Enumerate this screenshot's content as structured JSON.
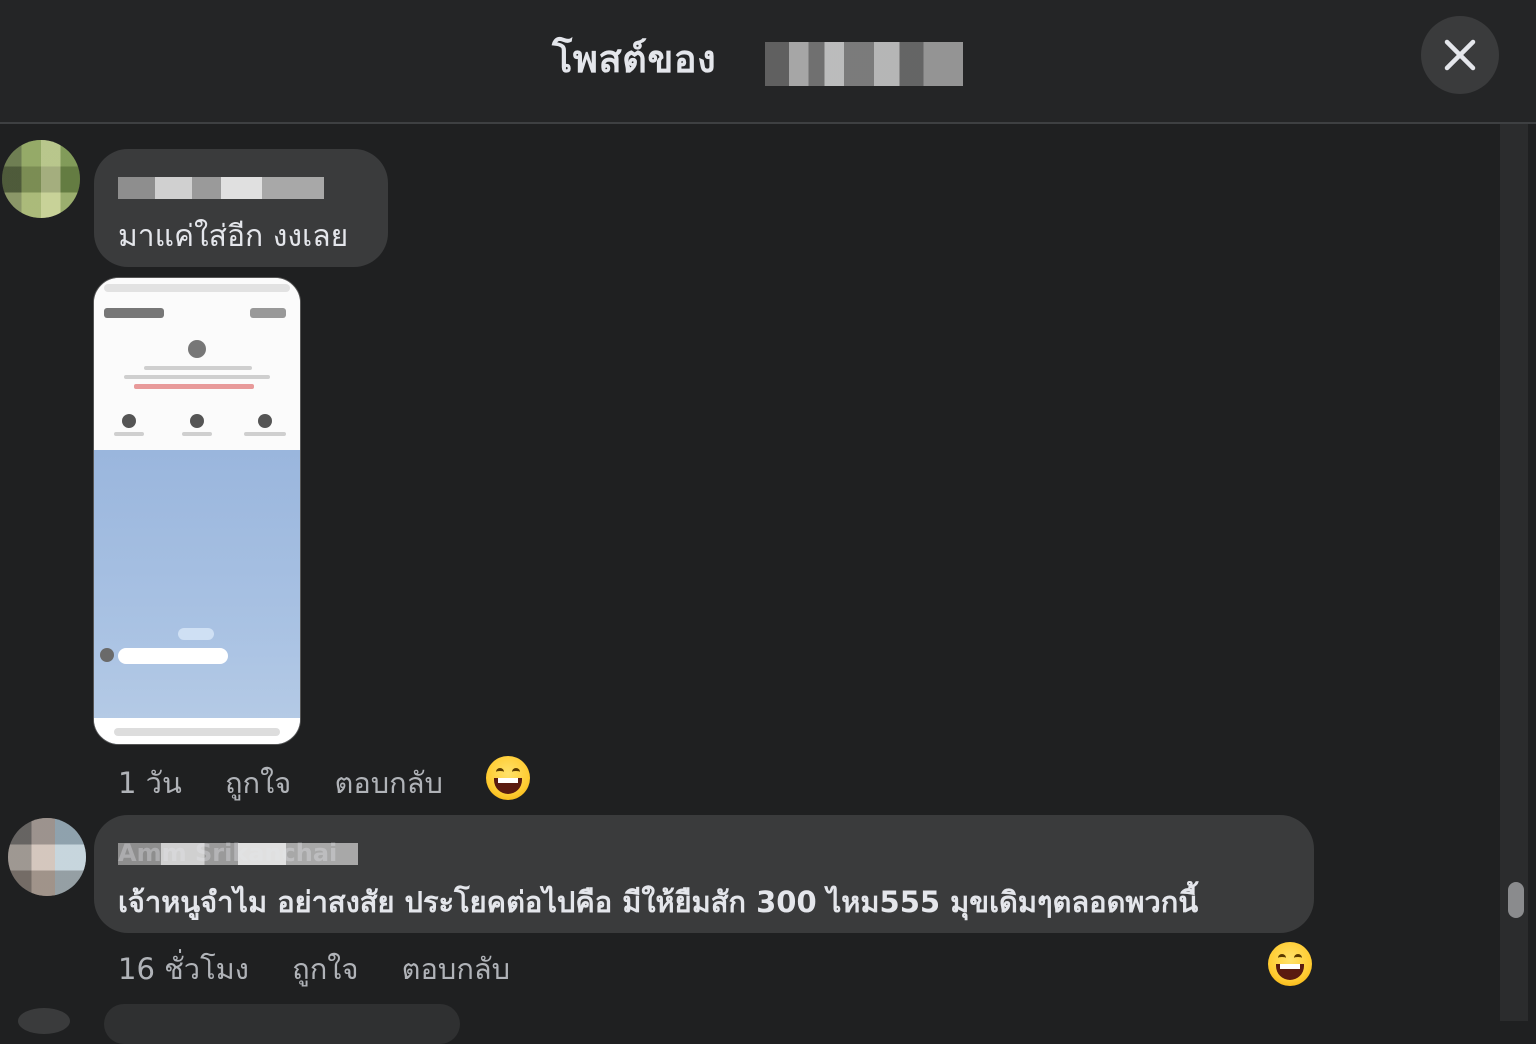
{
  "header": {
    "title": "โพสต์ของ",
    "close_icon": "close-icon"
  },
  "comments": [
    {
      "text": "มาแค่ใส่อีก งงเลย",
      "actions": {
        "time": "1 วัน",
        "like": "ถูกใจ",
        "reply": "ตอบกลับ"
      },
      "reaction_icon": "laughing-emoji-icon"
    },
    {
      "author_visible": "Amm Srikanchai",
      "text": "เจ้าหนูจำไม อย่าสงสัย ประโยคต่อไปคือ มีให้ยืมสัก 300 ไหม555 มุขเดิมๆตลอดพวกนี้",
      "actions": {
        "time": "16 ชั่วโมง",
        "like": "ถูกใจ",
        "reply": "ตอบกลับ"
      },
      "reaction_icon": "laughing-emoji-icon"
    }
  ],
  "colors": {
    "background": "#1f2021",
    "header": "#242526",
    "bubble": "#3a3b3c",
    "text": "#e4e6eb",
    "meta_text": "#b0b3b8"
  }
}
